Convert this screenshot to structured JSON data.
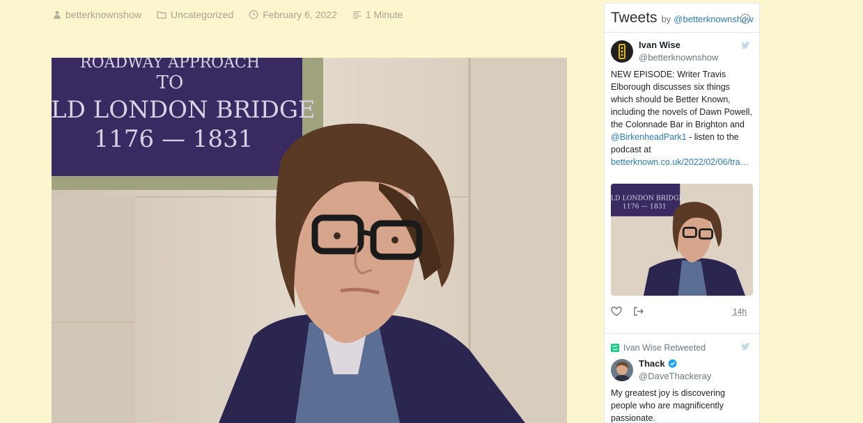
{
  "post_meta": {
    "author": "betterknownshow",
    "category": "Uncategorized",
    "date": "February 6, 2022",
    "read_time": "1 Minute"
  },
  "post_image": {
    "plaque_line_1": "ROADWAY APPROACH",
    "plaque_line_2": "TO",
    "plaque_line_3": "OLD LONDON BRIDGE",
    "plaque_line_4": "1176 — 1831"
  },
  "widget": {
    "title": "Tweets",
    "by": "by",
    "handle": "@betterknownshow",
    "tweets": [
      {
        "name": "Ivan Wise",
        "screen_name": "@betterknownshow",
        "text_1": "NEW EPISODE: Writer Travis Elborough discusses six things which should be Better Known, including the novels of Dawn Powell, the Colonnade Bar in Brighton and ",
        "mention": "@BirkenheadPark1",
        "text_2": " - listen to the podcast at ",
        "link": "betterknown.co.uk/2022/02/06/tra…",
        "time": "14h"
      },
      {
        "retweet_label": "Ivan Wise Retweeted",
        "name": "Thack",
        "screen_name": "@DaveThackeray",
        "text": "My greatest joy is discovering people who are magnificently passionate."
      }
    ]
  },
  "colors": {
    "page_bg": "#fcf6cf",
    "meta_text": "#a8a48c",
    "twitter_blue": "#1da1f2",
    "link": "#2b7bb9",
    "retweet_green": "#19cf86"
  },
  "icons": {
    "author": "user-icon",
    "category": "folder-icon",
    "date": "clock-icon",
    "read_time": "lines-icon",
    "info": "info-icon",
    "twitter": "twitter-bird-icon",
    "like": "heart-icon",
    "share": "share-icon",
    "retweet": "retweet-icon",
    "verified": "verified-badge-icon"
  }
}
